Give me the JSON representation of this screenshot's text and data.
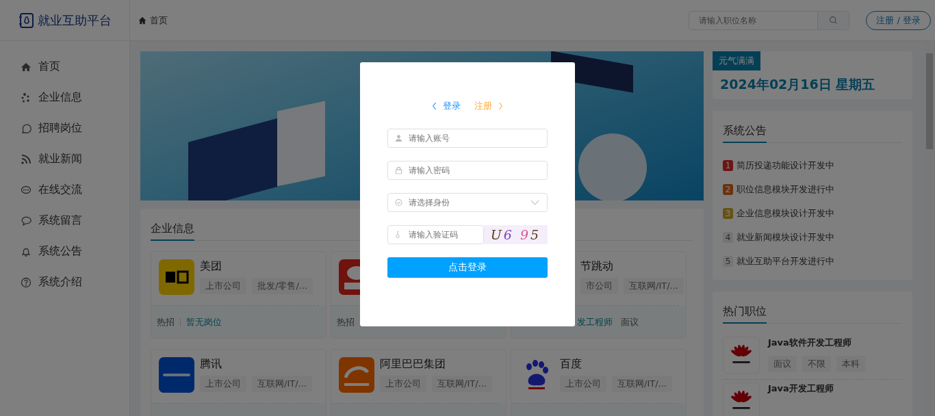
{
  "header": {
    "brand": "就业互助平台",
    "breadcrumb": "首页",
    "search": {
      "placeholder": "请输入职位名称"
    },
    "account_button": "注册 / 登录"
  },
  "sidebar": {
    "items": [
      {
        "label": "首页"
      },
      {
        "label": "企业信息"
      },
      {
        "label": "招聘岗位"
      },
      {
        "label": "就业新闻"
      },
      {
        "label": "在线交流"
      },
      {
        "label": "系统留言"
      },
      {
        "label": "系统公告"
      },
      {
        "label": "系统介绍"
      }
    ]
  },
  "companies": {
    "title": "企业信息",
    "rows": [
      [
        {
          "name": "美团",
          "tags": [
            "上市公司",
            "批发/零售/..."
          ],
          "hot_label": "热招",
          "jobs": [
            {
              "title": "暂无岗位"
            }
          ]
        },
        {
          "hot_label": "热招"
        },
        {
          "name": "节跳动",
          "tags": [
            "市公司",
            "互联网/IT/..."
          ],
          "jobs": [
            {
              "title": "发工程师",
              "salary": "面议"
            }
          ]
        }
      ],
      [
        {
          "name": "腾讯",
          "tags": [
            "上市公司",
            "互联网/IT/..."
          ]
        },
        {
          "name": "阿里巴巴集团",
          "tags": [
            "上市公司",
            "互联网/IT/..."
          ]
        },
        {
          "name": "百度",
          "tags": [
            "上市公司",
            "互联网/IT/..."
          ]
        }
      ]
    ]
  },
  "date_card": {
    "tag": "元气满满",
    "date": "2024年02月16日 星期五"
  },
  "notices": {
    "title": "系统公告",
    "items": [
      {
        "number": "1",
        "text": "简历投递功能设计开发中",
        "color": "#6d1417"
      },
      {
        "number": "2",
        "text": "职位信息模块开发进行中",
        "color": "#6c320e"
      },
      {
        "number": "3",
        "text": "企业信息模块设计开发中",
        "color": "#655215"
      },
      {
        "number": "4",
        "text": "就业新闻模块设计开发中",
        "color": "#747474"
      },
      {
        "number": "5",
        "text": "就业互助平台开发进行中",
        "color": "#757575"
      }
    ]
  },
  "hot_jobs": {
    "title": "热门职位",
    "items": [
      {
        "title": "Java软件开发工程师",
        "tags": [
          "面议",
          "不限",
          "本科"
        ]
      },
      {
        "title": "Java开发工程师"
      }
    ]
  },
  "login_dialog": {
    "tabs": [
      {
        "label": "登录",
        "selected": true
      },
      {
        "label": "注册",
        "selected": false
      }
    ],
    "fields": [
      {
        "kind": "account",
        "placeholder": "请输入账号"
      },
      {
        "kind": "password",
        "placeholder": "请输入密码"
      },
      {
        "kind": "select",
        "placeholder": "请选择身份"
      }
    ],
    "captcha": {
      "placeholder": "请输入验证码",
      "code": "U6 95"
    },
    "submit": "点击登录"
  }
}
